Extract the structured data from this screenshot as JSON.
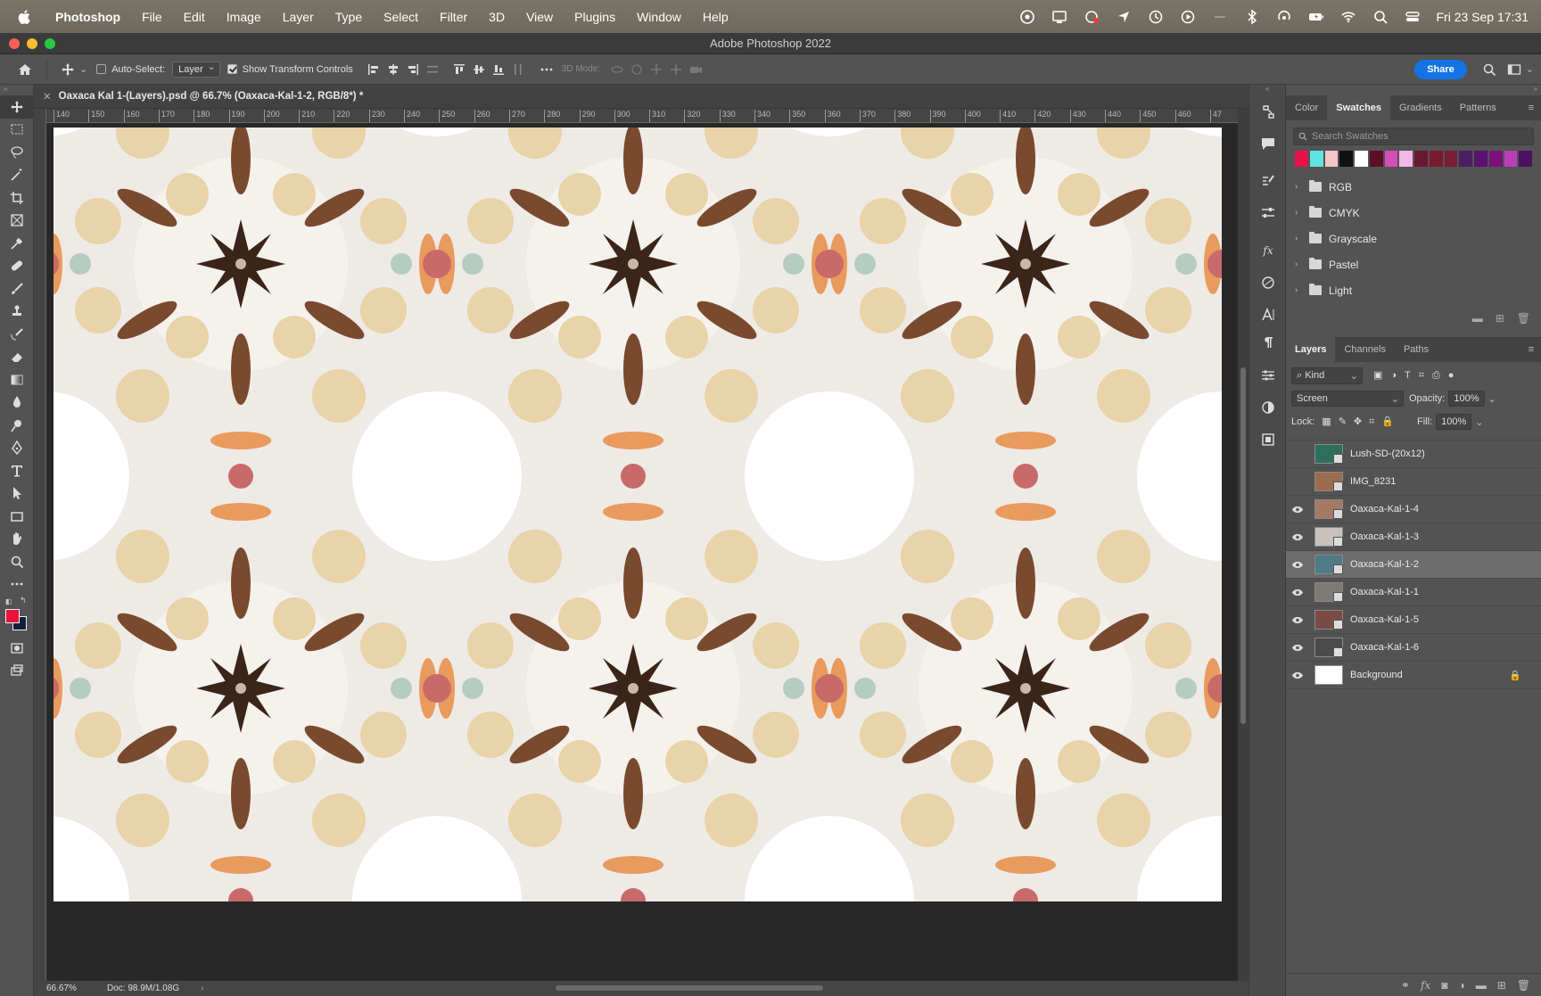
{
  "menubar": {
    "app_name": "Photoshop",
    "menus": [
      "File",
      "Edit",
      "Image",
      "Layer",
      "Type",
      "Select",
      "Filter",
      "3D",
      "View",
      "Plugins",
      "Window",
      "Help"
    ],
    "status_icons": [
      "creative-cloud-icon",
      "display-icon",
      "sync-icon",
      "location-icon",
      "time-machine-icon",
      "play-icon",
      "blank-icon",
      "bluetooth-icon",
      "airdrop-icon",
      "battery-icon",
      "wifi-icon",
      "spotlight-icon",
      "control-center-icon"
    ],
    "clock": "Fri 23 Sep  17:31"
  },
  "window": {
    "title": "Adobe Photoshop 2022"
  },
  "options_bar": {
    "auto_select_label": "Auto-Select:",
    "auto_select_value": "Layer",
    "show_transform_label": "Show Transform Controls",
    "mode_3d_label": "3D Mode:",
    "share_label": "Share"
  },
  "document": {
    "tab_title": "Oaxaca Kal 1-(Layers).psd @ 66.7% (Oaxaca-Kal-1-2, RGB/8*) *",
    "ruler_ticks": [
      "140",
      "150",
      "160",
      "170",
      "180",
      "190",
      "200",
      "210",
      "220",
      "230",
      "240",
      "250",
      "260",
      "270",
      "280",
      "290",
      "300",
      "310",
      "320",
      "330",
      "340",
      "350",
      "360",
      "370",
      "380",
      "390",
      "400",
      "410",
      "420",
      "430",
      "440",
      "450",
      "460",
      "47"
    ],
    "zoom": "66.67%",
    "doc_size": "Doc: 98.9M/1.08G"
  },
  "swatches_panel": {
    "tabs": [
      "Color",
      "Swatches",
      "Gradients",
      "Patterns"
    ],
    "active_tab": "Swatches",
    "search_placeholder": "Search Swatches",
    "recent_colors": [
      "#e8124a",
      "#5fe3e3",
      "#f4c6cc",
      "#111111",
      "#ffffff",
      "#5c0f22",
      "#d34fb8",
      "#f4b6e8",
      "#6a1832",
      "#7a1a2e",
      "#7a1e36",
      "#4b1d63",
      "#5a1270",
      "#7b117c",
      "#b83fb8",
      "#4a1260"
    ],
    "groups": [
      "RGB",
      "CMYK",
      "Grayscale",
      "Pastel",
      "Light"
    ]
  },
  "layers_panel": {
    "tabs": [
      "Layers",
      "Channels",
      "Paths"
    ],
    "active_tab": "Layers",
    "kind_label": "Kind",
    "blend_mode": "Screen",
    "opacity_label": "Opacity:",
    "opacity_value": "100%",
    "lock_label": "Lock:",
    "fill_label": "Fill:",
    "fill_value": "100%",
    "layers": [
      {
        "name": "Lush-SD-(20x12)",
        "visible": false,
        "selected": false,
        "thumb": "#2e6f5c"
      },
      {
        "name": "IMG_8231",
        "visible": false,
        "selected": false,
        "thumb": "#9b6d4e"
      },
      {
        "name": "Oaxaca-Kal-1-4",
        "visible": true,
        "selected": false,
        "thumb": "#a47a62"
      },
      {
        "name": "Oaxaca-Kal-1-3",
        "visible": true,
        "selected": false,
        "thumb": "#c7c2bd"
      },
      {
        "name": "Oaxaca-Kal-1-2",
        "visible": true,
        "selected": true,
        "thumb": "#4f7a86"
      },
      {
        "name": "Oaxaca-Kal-1-1",
        "visible": true,
        "selected": false,
        "thumb": "#7d7b73"
      },
      {
        "name": "Oaxaca-Kal-1-5",
        "visible": true,
        "selected": false,
        "thumb": "#7a4a44"
      },
      {
        "name": "Oaxaca-Kal-1-6",
        "visible": true,
        "selected": false,
        "thumb": "#4b4b4b"
      },
      {
        "name": "Background",
        "visible": true,
        "selected": false,
        "thumb": "#ffffff"
      }
    ]
  },
  "colors": {
    "foreground": "#e8123c",
    "background": "#10203a",
    "accent": "#1473e6"
  }
}
